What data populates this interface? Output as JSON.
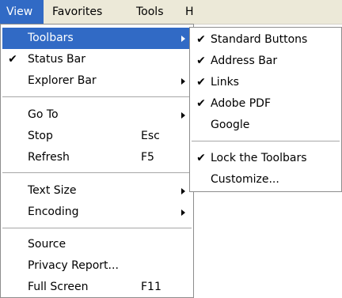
{
  "menubar": {
    "items": [
      {
        "label": "View"
      },
      {
        "label": "Favorites"
      },
      {
        "label": "Tools"
      },
      {
        "label": "H"
      }
    ]
  },
  "view_menu": {
    "items": [
      {
        "label": "Toolbars",
        "has_submenu": true,
        "highlighted": true,
        "checked": false,
        "shortcut": ""
      },
      {
        "label": "Status Bar",
        "checked": true,
        "shortcut": ""
      },
      {
        "label": "Explorer Bar",
        "has_submenu": true,
        "checked": false,
        "shortcut": ""
      },
      {
        "label": "Go To",
        "has_submenu": true,
        "checked": false,
        "shortcut": ""
      },
      {
        "label": "Stop",
        "checked": false,
        "shortcut": "Esc"
      },
      {
        "label": "Refresh",
        "checked": false,
        "shortcut": "F5"
      },
      {
        "label": "Text Size",
        "has_submenu": true,
        "checked": false,
        "shortcut": ""
      },
      {
        "label": "Encoding",
        "has_submenu": true,
        "checked": false,
        "shortcut": ""
      },
      {
        "label": "Source",
        "checked": false,
        "shortcut": ""
      },
      {
        "label": "Privacy Report...",
        "checked": false,
        "shortcut": ""
      },
      {
        "label": "Full Screen",
        "checked": false,
        "shortcut": "F11"
      }
    ]
  },
  "toolbars_submenu": {
    "items": [
      {
        "label": "Standard Buttons",
        "checked": true
      },
      {
        "label": "Address Bar",
        "checked": true
      },
      {
        "label": "Links",
        "checked": true
      },
      {
        "label": "Adobe PDF",
        "checked": true
      },
      {
        "label": "Google",
        "checked": false
      },
      {
        "label": "Lock the Toolbars",
        "checked": true
      },
      {
        "label": "Customize...",
        "checked": false
      }
    ]
  },
  "icons": {
    "check": "✔"
  },
  "colors": {
    "highlight": "#316ac5",
    "menubar": "#ece9d8"
  }
}
